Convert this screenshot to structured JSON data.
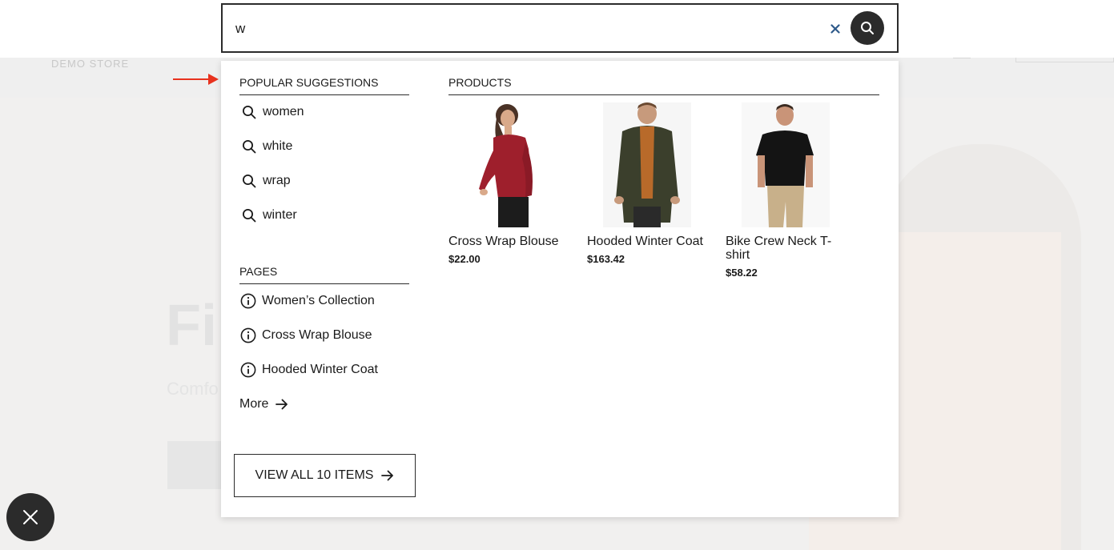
{
  "background": {
    "logo": "DEMO STORE",
    "hero_title": "Fi",
    "hero_subtitle": "Comfo"
  },
  "search": {
    "value": "w",
    "placeholder": ""
  },
  "suggestions": {
    "heading": "POPULAR SUGGESTIONS",
    "items": [
      {
        "label": "women",
        "icon": "search-icon"
      },
      {
        "label": "white",
        "icon": "search-icon"
      },
      {
        "label": "wrap",
        "icon": "search-icon"
      },
      {
        "label": "winter",
        "icon": "search-icon"
      }
    ]
  },
  "pages": {
    "heading": "PAGES",
    "items": [
      {
        "label": "Women’s Collection",
        "icon": "info-icon"
      },
      {
        "label": "Cross Wrap Blouse",
        "icon": "info-icon"
      },
      {
        "label": "Hooded Winter Coat",
        "icon": "info-icon"
      }
    ],
    "more_label": "More"
  },
  "view_all": {
    "label": "VIEW ALL 10 ITEMS"
  },
  "products": {
    "heading": "PRODUCTS",
    "items": [
      {
        "name": "Cross Wrap Blouse",
        "price": "$22.00",
        "image": "woman-red-off-shoulder-blouse"
      },
      {
        "name": "Hooded Winter Coat",
        "price": "$163.42",
        "image": "man-olive-hooded-coat"
      },
      {
        "name": "Bike Crew Neck T-shirt",
        "price": "$58.22",
        "image": "man-black-tshirt"
      }
    ]
  },
  "colors": {
    "dark": "#2b2b2b",
    "clear_x": "#2e5a8a",
    "arrow": "#e8321e"
  }
}
